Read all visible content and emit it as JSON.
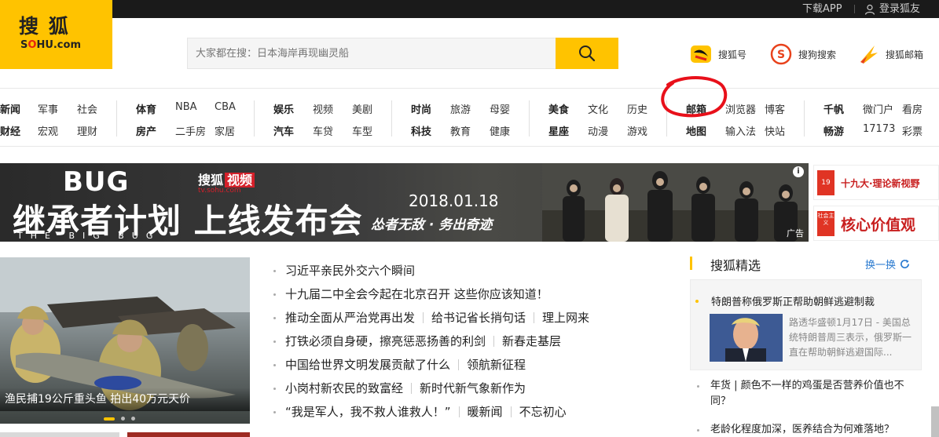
{
  "topbar": {
    "download_app": "下载APP",
    "login": "登录狐友"
  },
  "logo": {
    "cn": "搜 狐",
    "en_o": "O",
    "en_rest_a": "S",
    "en_rest_b": "HU.com"
  },
  "search": {
    "placeholder": "大家都在搜：日本海岸再现幽灵船"
  },
  "quick_links": [
    {
      "label": "搜狐号",
      "icon": "sohu-hao-icon"
    },
    {
      "label": "搜狗搜索",
      "icon": "sogou-search-icon"
    },
    {
      "label": "搜狐邮箱",
      "icon": "sohu-mail-icon"
    }
  ],
  "nav": {
    "g1": {
      "r1": [
        "新闻",
        "军事",
        "社会"
      ],
      "r2": [
        "财经",
        "宏观",
        "理财"
      ]
    },
    "g2": {
      "r1": [
        "体育",
        "NBA",
        "CBA"
      ],
      "r2": [
        "房产",
        "二手房",
        "家居"
      ]
    },
    "g3": {
      "r1": [
        "娱乐",
        "视频",
        "美剧"
      ],
      "r2": [
        "汽车",
        "车贷",
        "车型"
      ]
    },
    "g4": {
      "r1": [
        "时尚",
        "旅游",
        "母婴"
      ],
      "r2": [
        "科技",
        "教育",
        "健康"
      ]
    },
    "g5": {
      "r1": [
        "美食",
        "文化",
        "历史"
      ],
      "r2": [
        "星座",
        "动漫",
        "游戏"
      ]
    },
    "g6": {
      "r1": [
        "邮箱",
        "浏览器",
        "博客"
      ],
      "r2": [
        "地图",
        "输入法",
        "快站"
      ]
    },
    "g7": {
      "r1": [
        "千帆",
        "微门户",
        "看房"
      ],
      "r2": [
        "畅游",
        "17173",
        "彩票"
      ]
    }
  },
  "banner": {
    "bug": "BUG",
    "brand": "搜狐",
    "brand_tag": "视频",
    "brand_url": "tv.sohu.com",
    "title": "继承者计划 上线发布会",
    "subtitle": "THE BIG BUG",
    "date": "2018.01.18",
    "slogan": "怂者无敌 · 务出奇迹",
    "ad": "广告",
    "info": "i"
  },
  "promos": [
    {
      "text": "十九大·理论新视野",
      "seal": "19"
    },
    {
      "text": "核心价值观",
      "seal": "社会主义"
    }
  ],
  "feature": {
    "caption": "渔民捕19公斤重头鱼 拍出40万元天价"
  },
  "news": [
    [
      "习近平亲民外交六个瞬间"
    ],
    [
      "十九届二中全会今起在北京召开 这些你应该知道！"
    ],
    [
      "推动全面从严治党再出发",
      "给书记省长捎句话",
      "理上网来"
    ],
    [
      "打铁必须自身硬，擦亮惩恶扬善的利剑",
      "新春走基层"
    ],
    [
      "中国给世界文明发展贡献了什么",
      "领航新征程"
    ],
    [
      "小岗村新农民的致富经",
      "新时代新气象新作为"
    ],
    [
      "“我是军人，我不救人谁救人！”",
      "暖新闻",
      "不忘初心"
    ]
  ],
  "right": {
    "title": "搜狐精选",
    "refresh": "换一换",
    "headline": "特朗普称俄罗斯正帮助朝鲜逃避制裁",
    "desc": "路透华盛顿1月17日 - 美国总统特朗普周三表示，俄罗斯一直在帮助朝鲜逃避国际...",
    "items": [
      "年货 | 颜色不一样的鸡蛋是否营养价值也不同？",
      "老龄化程度加深，医养结合为何难落地？"
    ]
  },
  "colors": {
    "brand_yellow": "#ffc300",
    "link_blue": "#2b7bd0",
    "annotation_red": "#e8101a"
  }
}
